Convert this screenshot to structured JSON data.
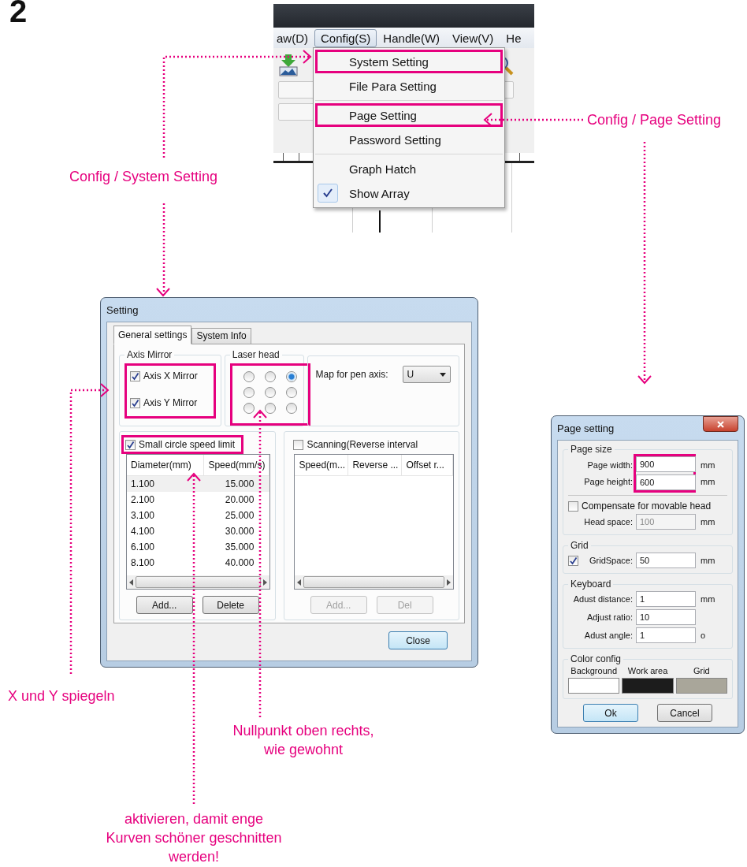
{
  "step_number": "2",
  "menu_screenshot": {
    "menubar": [
      {
        "label": "aw(D)",
        "selected": false
      },
      {
        "label": "Config(S)",
        "selected": true
      },
      {
        "label": "Handle(W)",
        "selected": false
      },
      {
        "label": "View(V)",
        "selected": false
      },
      {
        "label": "He",
        "selected": false
      }
    ],
    "items": [
      {
        "label": "System Setting",
        "checked": false,
        "highlighted": true,
        "separator_after": false
      },
      {
        "label": "File Para Setting",
        "checked": false,
        "highlighted": false,
        "separator_after": true
      },
      {
        "label": "Page Setting",
        "checked": false,
        "highlighted": true,
        "separator_after": false
      },
      {
        "label": "Password Setting",
        "checked": false,
        "highlighted": false,
        "separator_after": true
      },
      {
        "label": "Graph Hatch",
        "checked": false,
        "highlighted": false,
        "separator_after": false
      },
      {
        "label": "Show Array",
        "checked": true,
        "highlighted": false,
        "separator_after": false
      }
    ]
  },
  "setting_dialog": {
    "title": "Setting",
    "tabs": [
      {
        "label": "General settings",
        "selected": true
      },
      {
        "label": "System Info",
        "selected": false
      }
    ],
    "axis_mirror": {
      "title": "Axis Mirror",
      "highlighted": true,
      "options": [
        {
          "label": "Axis X Mirror",
          "checked": true
        },
        {
          "label": "Axis Y Mirror",
          "checked": true
        }
      ]
    },
    "laser_head": {
      "title": "Laser head",
      "highlighted": true,
      "positions": [
        {
          "selected": false
        },
        {
          "selected": false
        },
        {
          "selected": true
        },
        {
          "selected": false
        },
        {
          "selected": false
        },
        {
          "selected": false
        },
        {
          "selected": false
        },
        {
          "selected": false
        },
        {
          "selected": false
        }
      ]
    },
    "pen_axis": {
      "label": "Map for pen axis:",
      "value": "U"
    },
    "speed_limit": {
      "label": "Small circle speed limit",
      "checked": true,
      "highlighted": true,
      "columns": [
        "Diameter(mm)",
        "Speed(mm/s)"
      ],
      "rows": [
        {
          "cells": [
            "1.100",
            "15.000"
          ],
          "selected": true
        },
        {
          "cells": [
            "2.100",
            "20.000"
          ],
          "selected": false
        },
        {
          "cells": [
            "3.100",
            "25.000"
          ],
          "selected": false
        },
        {
          "cells": [
            "4.100",
            "30.000"
          ],
          "selected": false
        },
        {
          "cells": [
            "6.100",
            "35.000"
          ],
          "selected": false
        },
        {
          "cells": [
            "8.100",
            "40.000"
          ],
          "selected": false
        }
      ],
      "buttons": [
        {
          "label": "Add...",
          "disabled": false
        },
        {
          "label": "Delete",
          "disabled": false
        }
      ]
    },
    "scanning": {
      "label": "Scanning(Reverse interval",
      "checked": false,
      "columns": [
        "Speed(m...",
        "Reverse ...",
        "Offset r..."
      ],
      "buttons": [
        {
          "label": "Add...",
          "disabled": true
        },
        {
          "label": "Del",
          "disabled": true
        }
      ]
    },
    "close_button": "Close"
  },
  "page_dialog": {
    "title": "Page setting",
    "page_size": {
      "title": "Page size",
      "highlighted": true,
      "fields": [
        {
          "label": "Page width:",
          "value": "900",
          "unit": "mm"
        },
        {
          "label": "Page height:",
          "value": "600",
          "unit": "mm"
        }
      ],
      "compensate": {
        "label": "Compensate for movable head",
        "checked": false
      },
      "head_space": {
        "label": "Head space:",
        "value": "100",
        "unit": "mm",
        "disabled": true
      }
    },
    "grid": {
      "title": "Grid",
      "checked": true,
      "label": "GridSpace:",
      "value": "50",
      "unit": "mm"
    },
    "keyboard": {
      "title": "Keyboard",
      "fields": [
        {
          "label": "Adust distance:",
          "value": "1",
          "unit": "mm"
        },
        {
          "label": "Adjust ratio:",
          "value": "10"
        },
        {
          "label": "Adust angle:",
          "value": "1",
          "unit": "o"
        }
      ]
    },
    "color_config": {
      "title": "Color config",
      "swatches": [
        {
          "label": "Background",
          "color": "#ffffff"
        },
        {
          "label": "Work area",
          "color": "#1c1c1c"
        },
        {
          "label": "Grid",
          "color": "#a9a69a"
        }
      ]
    },
    "buttons": [
      "Ok",
      "Cancel"
    ]
  },
  "annotations": [
    {
      "lines": [
        "Config / System Setting"
      ]
    },
    {
      "lines": [
        "Config / Page Setting"
      ]
    },
    {
      "lines": [
        "X und Y spiegeln"
      ]
    },
    {
      "lines": [
        "Nullpunkt oben rechts,",
        "wie gewohnt"
      ]
    },
    {
      "lines": [
        "aktivieren, damit enge",
        "Kurven schöner geschnitten",
        "werden!"
      ]
    }
  ]
}
